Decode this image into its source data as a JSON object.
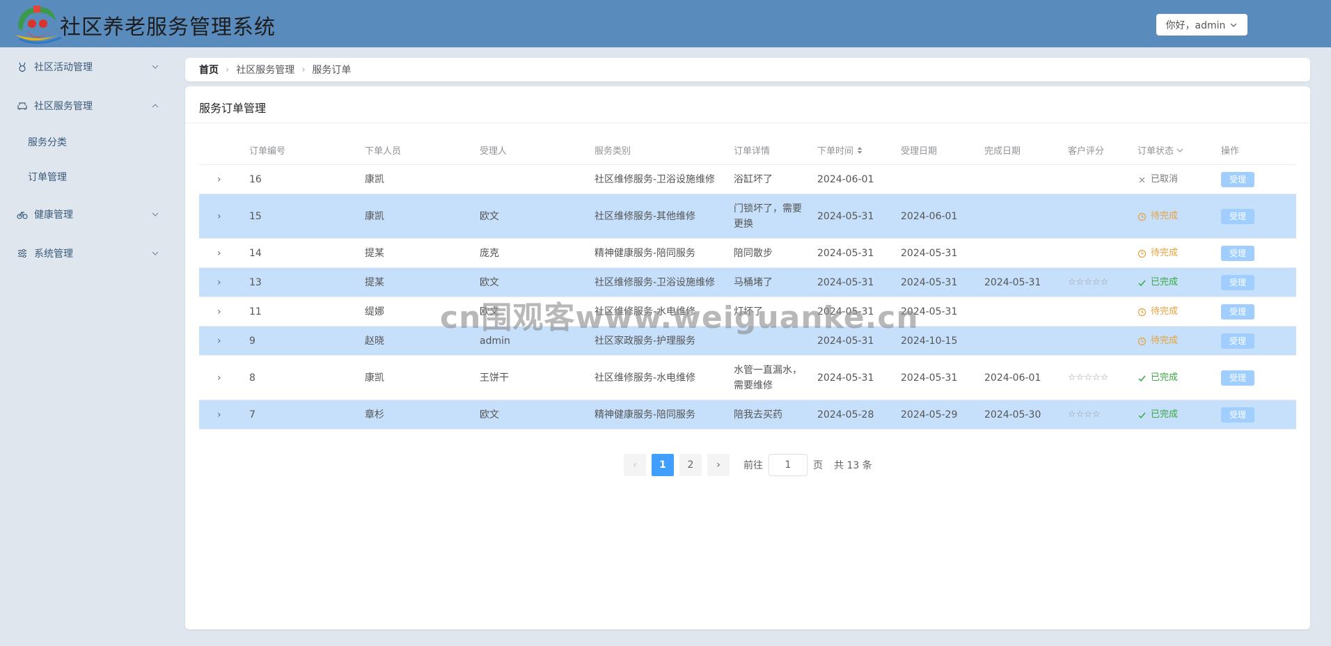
{
  "app": {
    "title": "社区养老服务管理系统"
  },
  "header": {
    "user_greeting": "你好，admin"
  },
  "sidebar": {
    "items": [
      {
        "label": "社区活动管理",
        "icon": "medal-icon",
        "expanded": false
      },
      {
        "label": "社区服务管理",
        "icon": "sofa-icon",
        "expanded": true,
        "children": [
          {
            "label": "服务分类"
          },
          {
            "label": "订单管理"
          }
        ]
      },
      {
        "label": "健康管理",
        "icon": "bicycle-icon",
        "expanded": false
      },
      {
        "label": "系统管理",
        "icon": "sliders-icon",
        "expanded": false
      }
    ]
  },
  "breadcrumb": {
    "home": "首页",
    "level1": "社区服务管理",
    "level2": "服务订单"
  },
  "card": {
    "title": "服务订单管理"
  },
  "table": {
    "columns": {
      "order_no": "订单编号",
      "customer": "下单人员",
      "handler": "受理人",
      "category": "服务类别",
      "detail": "订单详情",
      "order_time": "下单时间",
      "accept_date": "受理日期",
      "finish_date": "完成日期",
      "rating": "客户评分",
      "status": "订单状态",
      "action": "操作"
    },
    "rows": [
      {
        "id": "16",
        "customer": "康凯",
        "handler": "",
        "category": "社区维修服务-卫浴设施维修",
        "detail": "浴缸坏了",
        "order_time": "2024-06-01",
        "accept_date": "",
        "finish_date": "",
        "rating": "",
        "status": "已取消",
        "status_type": "cancel",
        "action": "受理"
      },
      {
        "id": "15",
        "customer": "康凯",
        "handler": "欧文",
        "category": "社区维修服务-其他维修",
        "detail": "门锁坏了，需要更换",
        "order_time": "2024-05-31",
        "accept_date": "2024-06-01",
        "finish_date": "",
        "rating": "",
        "status": "待完成",
        "status_type": "pending",
        "action": "受理"
      },
      {
        "id": "14",
        "customer": "提某",
        "handler": "庞克",
        "category": "精神健康服务-陪同服务",
        "detail": "陪同散步",
        "order_time": "2024-05-31",
        "accept_date": "2024-05-31",
        "finish_date": "",
        "rating": "",
        "status": "待完成",
        "status_type": "pending",
        "action": "受理"
      },
      {
        "id": "13",
        "customer": "提某",
        "handler": "欧文",
        "category": "社区维修服务-卫浴设施维修",
        "detail": "马桶堵了",
        "order_time": "2024-05-31",
        "accept_date": "2024-05-31",
        "finish_date": "2024-05-31",
        "rating": "☆☆☆☆☆",
        "status": "已完成",
        "status_type": "done",
        "action": "受理"
      },
      {
        "id": "11",
        "customer": "缇娜",
        "handler": "欧文",
        "category": "社区维修服务-水电维修",
        "detail": "灯坏了",
        "order_time": "2024-05-31",
        "accept_date": "2024-05-31",
        "finish_date": "",
        "rating": "",
        "status": "待完成",
        "status_type": "pending",
        "action": "受理"
      },
      {
        "id": "9",
        "customer": "赵晓",
        "handler": "admin",
        "category": "社区家政服务-护理服务",
        "detail": "",
        "order_time": "2024-05-31",
        "accept_date": "2024-10-15",
        "finish_date": "",
        "rating": "",
        "status": "待完成",
        "status_type": "pending",
        "action": "受理"
      },
      {
        "id": "8",
        "customer": "康凯",
        "handler": "王饼干",
        "category": "社区维修服务-水电维修",
        "detail": "水管一直漏水，需要维修",
        "order_time": "2024-05-31",
        "accept_date": "2024-05-31",
        "finish_date": "2024-06-01",
        "rating": "☆☆☆☆☆",
        "status": "已完成",
        "status_type": "done",
        "action": "受理"
      },
      {
        "id": "7",
        "customer": "章杉",
        "handler": "欧文",
        "category": "精神健康服务-陪同服务",
        "detail": "陪我去买药",
        "order_time": "2024-05-28",
        "accept_date": "2024-05-29",
        "finish_date": "2024-05-30",
        "rating": "☆☆☆☆",
        "status": "已完成",
        "status_type": "done",
        "action": "受理"
      }
    ]
  },
  "pagination": {
    "pages": [
      "1",
      "2"
    ],
    "current": "1",
    "goto_label": "前往",
    "goto_value": "1",
    "page_unit": "页",
    "total_text": "共 13 条"
  },
  "watermark": "cn围观客www.weiguanke.cn",
  "colors": {
    "header": "#5a8bbd",
    "accent": "#409eff",
    "done": "#3aa640",
    "pending": "#e6a23c",
    "stripe": "#c6e0fb"
  }
}
